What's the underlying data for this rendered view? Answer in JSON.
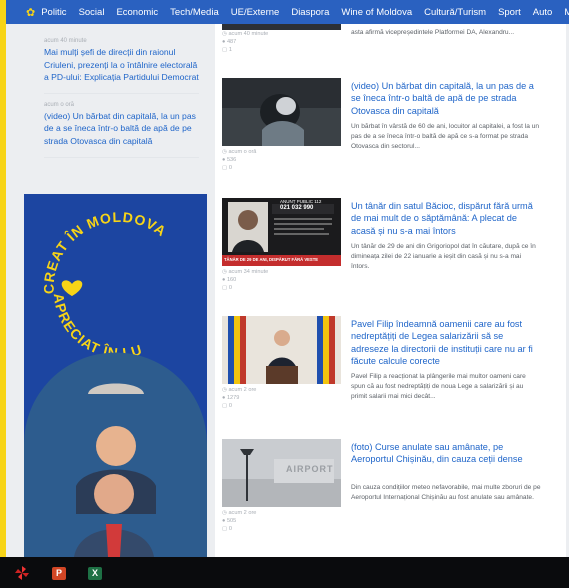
{
  "nav": {
    "items": [
      "Politic",
      "Social",
      "Economic",
      "Tech/Media",
      "UE/Externe",
      "Diaspora",
      "Wine of Moldova",
      "Cultură/Turism",
      "Sport",
      "Auto",
      "Mond"
    ]
  },
  "left_news": [
    {
      "time": "acum 40 minute",
      "title": "Mai mulți șefi de direcții din raionul Criuleni, prezenți la o întâlnire electorală a PD-ului: Explicația Partidului Democrat"
    },
    {
      "time": "acum o oră",
      "title": "(video) Un bărbat din capitală, la un pas de a se îneca într-o baltă de apă de pe strada Otovasca din capitală"
    }
  ],
  "ad": {
    "line1": "CREAT ÎN MOLDOVA",
    "line2": "APRECIAT ÎN LUME",
    "colors": {
      "bg": "#1c45a1",
      "text": "#f7d417"
    }
  },
  "articles": [
    {
      "time": "acum 40 minute",
      "views": "487",
      "comments": "1",
      "title": "",
      "excerpt": "asta afirmă vicepreședintele Platformei DA, Alexandru..."
    },
    {
      "time": "acum o oră",
      "views": "536",
      "comments": "0",
      "title": "(video) Un bărbat din capitală, la un pas de a se îneca într-o baltă de apă de pe strada Otovasca din capitală",
      "excerpt": "Un bărbat în vârstă de 60 de ani, locuitor al capitalei, a fost la un pas de a se îneca într-o baltă de apă ce s-a format pe strada Otovasca din sectorul..."
    },
    {
      "time": "acum 34 minute",
      "views": "160",
      "comments": "0",
      "title": "Un tânăr din satul Băcioc, dispărut fără urmă de mai mult de o săptămână: A plecat de acasă și nu s-a mai întors",
      "excerpt": "Un tânăr de 29 de ani din Grigoriopol dat în căutare, după ce în dimineața zilei de 22 ianuarie a ieșit din casă și nu s-a mai întors.",
      "thumb": {
        "hotline_label": "ANUNȚ PUBLIC 112",
        "phone": "021 032 990",
        "banner": "TÂNĂR DE 29 DE ANI, DISPĂRUT FĂRĂ VESTE"
      }
    },
    {
      "time": "acum 2 ore",
      "views": "1279",
      "comments": "0",
      "title": "Pavel Filip îndeamnă oamenii care au fost nedreptățiți de Legea salarizării să se adreseze la directorii de instituții care nu ar fi făcute calcule corecte",
      "excerpt": "Pavel Filip a reacționat la plângerile mai multor oameni care spun că au fost nedreptățiți de noua Lege a salarizării și au primit salarii mai mici decât..."
    },
    {
      "time": "acum 2 ore",
      "views": "505",
      "comments": "0",
      "title": "(foto) Curse anulate sau amânate, pe Aeroportul Chișinău, din cauza ceții dense",
      "excerpt": "Din cauza condițiilor meteo nefavorabile, mai multe zboruri de pe Aeroportul Internațional Chișinău au fost anulate sau amânate.",
      "thumb": {
        "sign": "AIRPORT"
      }
    }
  ],
  "taskbar": {
    "icons": [
      "pinwheel-icon",
      "powerpoint-icon",
      "excel-icon"
    ]
  }
}
